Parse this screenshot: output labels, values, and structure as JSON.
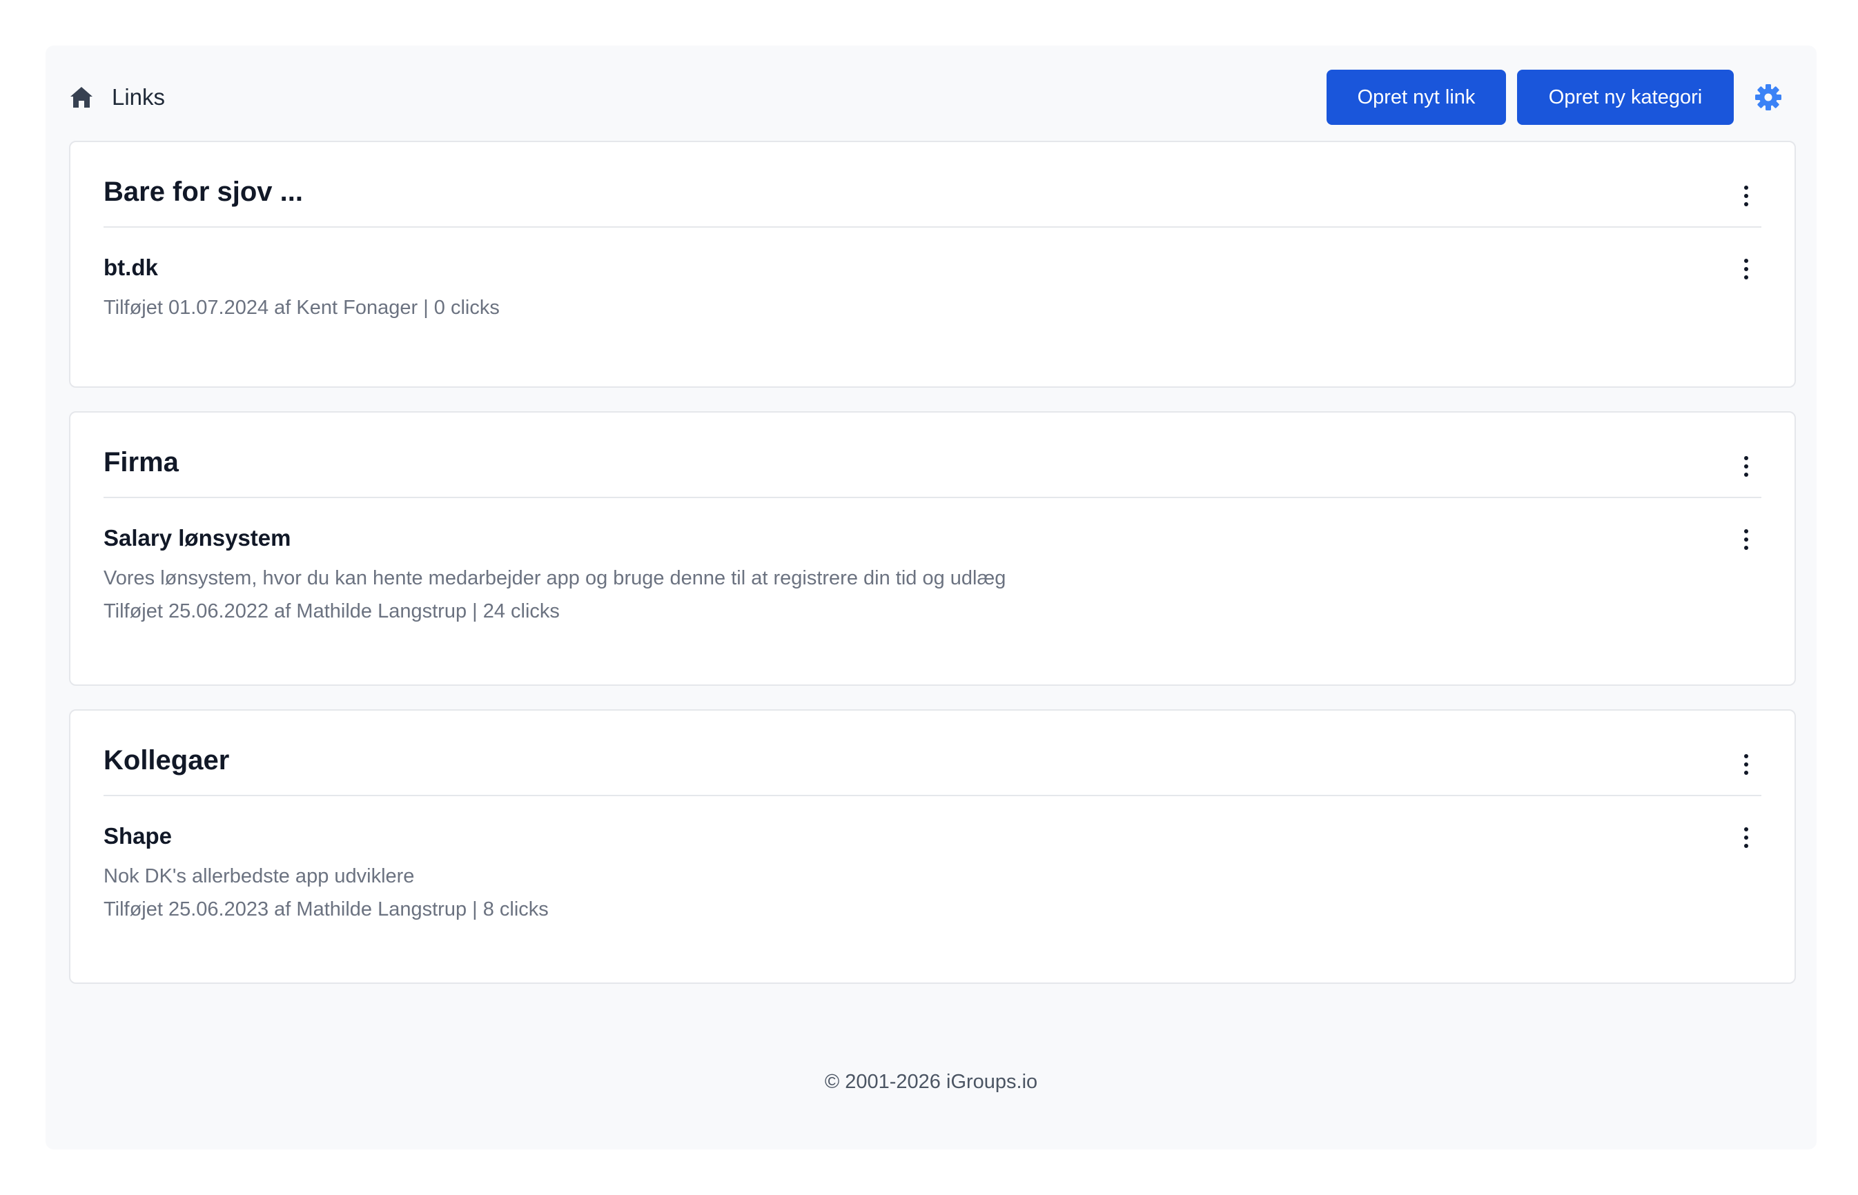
{
  "header": {
    "breadcrumb_label": "Links",
    "create_link_label": "Opret nyt link",
    "create_category_label": "Opret ny kategori"
  },
  "categories": [
    {
      "title": "Bare for sjov ...",
      "links": [
        {
          "title": "bt.dk",
          "description": "",
          "meta": "Tilføjet 01.07.2024 af Kent Fonager | 0 clicks"
        }
      ]
    },
    {
      "title": "Firma",
      "links": [
        {
          "title": "Salary lønsystem",
          "description": "Vores lønsystem, hvor du kan hente medarbejder app og bruge denne til at registrere din tid og udlæg",
          "meta": "Tilføjet 25.06.2022 af Mathilde Langstrup | 24 clicks"
        }
      ]
    },
    {
      "title": "Kollegaer",
      "links": [
        {
          "title": "Shape",
          "description": "Nok DK's allerbedste app udviklere",
          "meta": "Tilføjet 25.06.2023 af Mathilde Langstrup | 8 clicks"
        }
      ]
    }
  ],
  "footer": {
    "copyright": "© 2001-2026 iGroups.io"
  },
  "colors": {
    "accent": "#1a56db",
    "gear": "#3b82f6",
    "muted_text": "#6b7280"
  },
  "icons": [
    "home-icon",
    "gear-icon",
    "kebab-menu-icon"
  ]
}
